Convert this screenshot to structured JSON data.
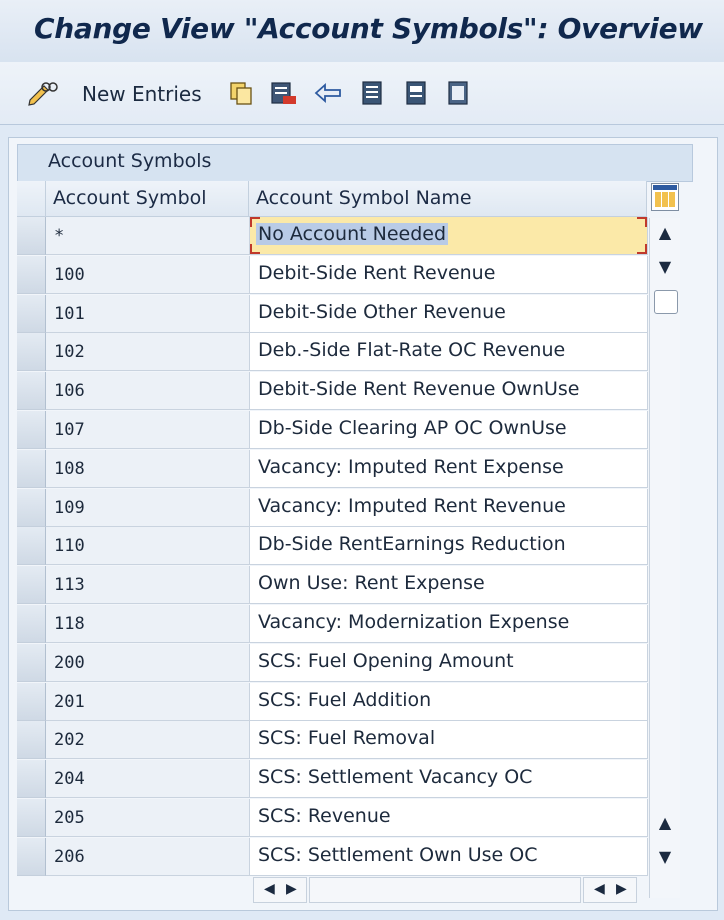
{
  "window": {
    "title": "Change View \"Account Symbols\": Overview"
  },
  "toolbar": {
    "new_entries_label": "New Entries"
  },
  "table": {
    "section_title": "Account Symbols",
    "columns": [
      "Account Symbol",
      "Account Symbol Name"
    ],
    "rows": [
      {
        "symbol": "*",
        "name": "No Account Needed",
        "selected": true
      },
      {
        "symbol": "100",
        "name": "Debit-Side Rent Revenue"
      },
      {
        "symbol": "101",
        "name": "Debit-Side Other Revenue"
      },
      {
        "symbol": "102",
        "name": "Deb.-Side Flat-Rate OC Revenue"
      },
      {
        "symbol": "106",
        "name": "Debit-Side Rent Revenue OwnUse"
      },
      {
        "symbol": "107",
        "name": "Db-Side Clearing AP OC OwnUse"
      },
      {
        "symbol": "108",
        "name": "Vacancy: Imputed Rent Expense"
      },
      {
        "symbol": "109",
        "name": "Vacancy: Imputed Rent Revenue"
      },
      {
        "symbol": "110",
        "name": "Db-Side RentEarnings Reduction"
      },
      {
        "symbol": "113",
        "name": "Own Use: Rent Expense"
      },
      {
        "symbol": "118",
        "name": "Vacancy: Modernization Expense"
      },
      {
        "symbol": "200",
        "name": "SCS: Fuel Opening Amount"
      },
      {
        "symbol": "201",
        "name": "SCS: Fuel Addition"
      },
      {
        "symbol": "202",
        "name": "SCS: Fuel Removal"
      },
      {
        "symbol": "204",
        "name": "SCS: Settlement Vacancy OC"
      },
      {
        "symbol": "205",
        "name": "SCS: Revenue"
      },
      {
        "symbol": "206",
        "name": "SCS: Settlement Own Use OC"
      }
    ]
  },
  "icons": {
    "display_change": "pencil-glasses-icon",
    "copy": "copy-icon",
    "delete": "delete-icon",
    "undo": "undo-icon",
    "select_all": "select-all-icon",
    "select_block": "select-block-icon",
    "deselect_all": "deselect-all-icon",
    "column_config": "column-config-icon"
  },
  "colors": {
    "title_text": "#10284d",
    "selected_row": "#fbe9a8",
    "selection_highlight": "#b9cbe6",
    "focus_marker": "#c0392b"
  }
}
